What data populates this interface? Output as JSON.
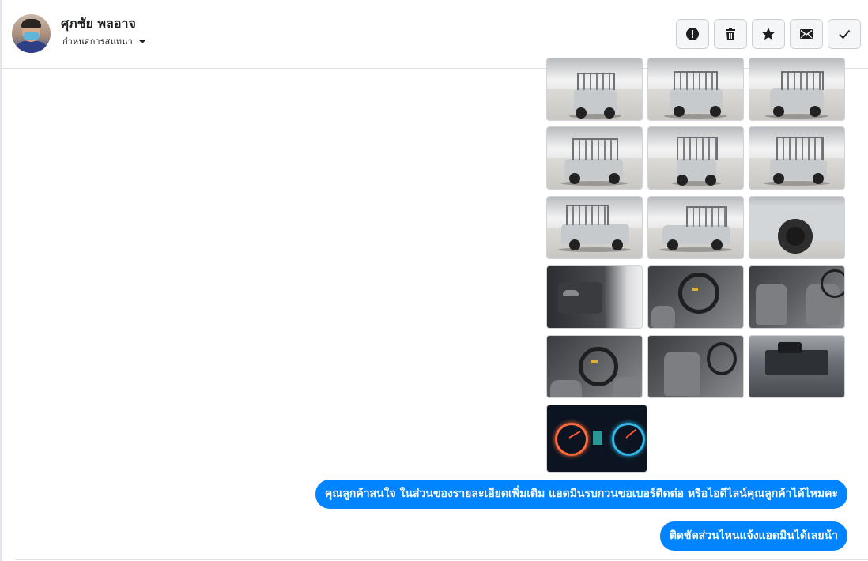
{
  "conversation": {
    "contact_name": "ศุภชัย พลอาจ",
    "subtitle": "กำหนดการสนทนา"
  },
  "actions": [
    {
      "name": "report",
      "icon": "exclamation-circle-icon"
    },
    {
      "name": "delete",
      "icon": "trash-icon"
    },
    {
      "name": "star",
      "icon": "star-icon"
    },
    {
      "name": "mark-unread",
      "icon": "envelope-icon"
    },
    {
      "name": "mark-done",
      "icon": "check-icon"
    }
  ],
  "gallery": {
    "photos": [
      {
        "subject": "exterior-front"
      },
      {
        "subject": "exterior-front-left"
      },
      {
        "subject": "exterior-front-right"
      },
      {
        "subject": "exterior-rear-left"
      },
      {
        "subject": "exterior-rear"
      },
      {
        "subject": "exterior-rear-right"
      },
      {
        "subject": "exterior-side-left"
      },
      {
        "subject": "exterior-side-right"
      },
      {
        "subject": "wheel-closeup"
      },
      {
        "subject": "interior-door"
      },
      {
        "subject": "interior-steering"
      },
      {
        "subject": "interior-seats"
      },
      {
        "subject": "interior-dashboard"
      },
      {
        "subject": "interior-cabin"
      },
      {
        "subject": "engine-bay"
      },
      {
        "subject": "gauge-cluster"
      }
    ]
  },
  "messages": [
    {
      "sender": "page",
      "text": "คุณลูกค้าสนใจ ในส่วนของรายละเอียดเพิ่มเติม แอดมินรบกวนขอเบอร์ติดต่อ หรือไอดีไลน์คุณลูกค้าได้ไหมคะ"
    },
    {
      "sender": "page",
      "text": "ติดขัดส่วนไหนแจ้งแอดมินได้เลยน้า"
    }
  ],
  "colors": {
    "bubble": "#0084ff",
    "bubble_text": "#ffffff"
  }
}
